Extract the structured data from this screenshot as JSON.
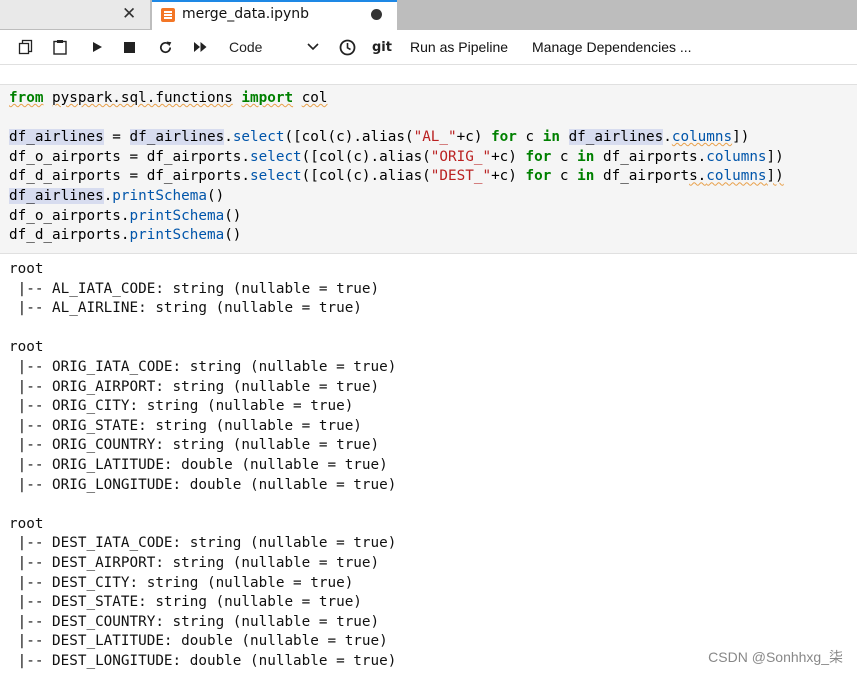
{
  "tabs": [
    {
      "title": "",
      "close_glyph": "✕"
    },
    {
      "title": "merge_data.ipynb",
      "icon": "notebook-icon",
      "unsaved_indicator": "●"
    }
  ],
  "toolbar": {
    "cell_type": "Code",
    "git_label": "git",
    "run_as_pipeline": "Run as Pipeline",
    "manage_dependencies": "Manage Dependencies ..."
  },
  "colors": {
    "accent": "#1e88e5",
    "keyword": "#008000",
    "string": "#ba2121",
    "function": "#0055aa"
  },
  "cell": {
    "lines": [
      "from pyspark.sql.functions import col",
      "",
      "df_airlines = df_airlines.select([col(c).alias(\"AL_\"+c) for c in df_airlines.columns])",
      "df_o_airports = df_airports.select([col(c).alias(\"ORIG_\"+c) for c in df_airports.columns])",
      "df_d_airports = df_airports.select([col(c).alias(\"DEST_\"+c) for c in df_airports.columns])",
      "df_airlines.printSchema()",
      "df_o_airports.printSchema()",
      "df_d_airports.printSchema()"
    ]
  },
  "output": {
    "lines": [
      "root",
      " |-- AL_IATA_CODE: string (nullable = true)",
      " |-- AL_AIRLINE: string (nullable = true)",
      "",
      "root",
      " |-- ORIG_IATA_CODE: string (nullable = true)",
      " |-- ORIG_AIRPORT: string (nullable = true)",
      " |-- ORIG_CITY: string (nullable = true)",
      " |-- ORIG_STATE: string (nullable = true)",
      " |-- ORIG_COUNTRY: string (nullable = true)",
      " |-- ORIG_LATITUDE: double (nullable = true)",
      " |-- ORIG_LONGITUDE: double (nullable = true)",
      "",
      "root",
      " |-- DEST_IATA_CODE: string (nullable = true)",
      " |-- DEST_AIRPORT: string (nullable = true)",
      " |-- DEST_CITY: string (nullable = true)",
      " |-- DEST_STATE: string (nullable = true)",
      " |-- DEST_COUNTRY: string (nullable = true)",
      " |-- DEST_LATITUDE: double (nullable = true)",
      " |-- DEST_LONGITUDE: double (nullable = true)"
    ]
  },
  "watermark": "CSDN @Sonhhxg_柒"
}
